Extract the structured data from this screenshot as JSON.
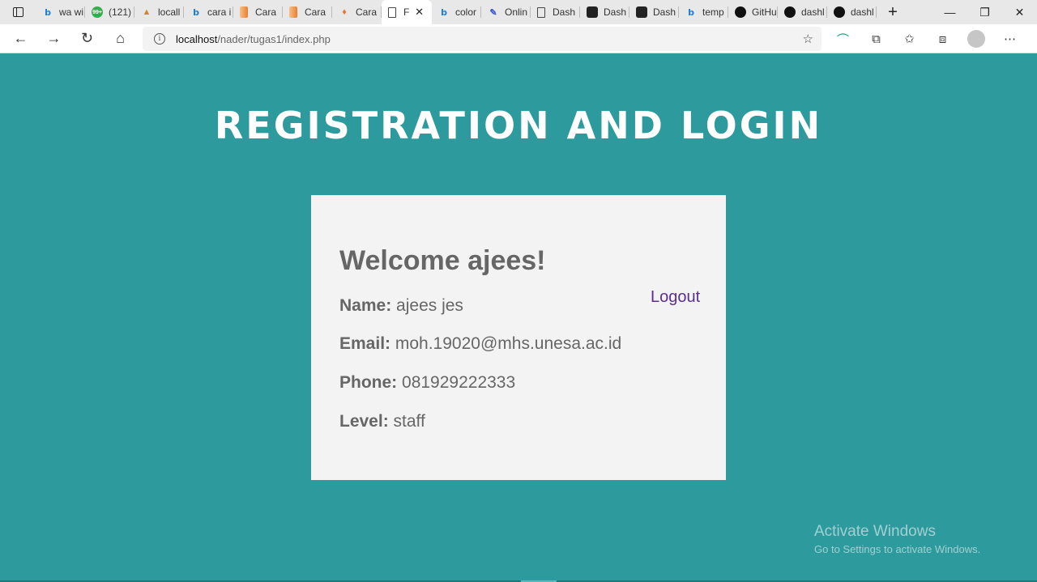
{
  "browser": {
    "tabs": [
      {
        "icon": "bing-icon",
        "label": "wa wi"
      },
      {
        "icon": "notification-icon",
        "label": "(121)"
      },
      {
        "icon": "chart-icon",
        "label": "locall"
      },
      {
        "icon": "bing-icon",
        "label": "cara i"
      },
      {
        "icon": "gradient-icon",
        "label": "Cara"
      },
      {
        "icon": "gradient-icon",
        "label": "Cara"
      },
      {
        "icon": "leaf-icon",
        "label": "Cara"
      },
      {
        "icon": "page-icon",
        "label": "F",
        "active": true
      },
      {
        "icon": "bing-icon",
        "label": "color"
      },
      {
        "icon": "pen-icon",
        "label": "Onlin"
      },
      {
        "icon": "page-icon",
        "label": "Dash"
      },
      {
        "icon": "dashboard-icon",
        "label": "Dash"
      },
      {
        "icon": "dashboard-icon",
        "label": "Dash"
      },
      {
        "icon": "bing-icon",
        "label": "temp"
      },
      {
        "icon": "github-icon",
        "label": "GitHu"
      },
      {
        "icon": "github-icon",
        "label": "dashl"
      },
      {
        "icon": "github-icon",
        "label": "dashl"
      }
    ],
    "address": {
      "host": "localhost",
      "path": "/nader/tugas1/index.php"
    }
  },
  "page": {
    "title": "REGISTRATION AND LOGIN",
    "welcome": "Welcome ajees!",
    "logout_label": "Logout",
    "fields": [
      {
        "label": "Name:",
        "value": "ajees jes"
      },
      {
        "label": "Email:",
        "value": "moh.19020@mhs.unesa.ac.id"
      },
      {
        "label": "Phone:",
        "value": "081929222333"
      },
      {
        "label": "Level:",
        "value": "staff"
      }
    ]
  },
  "watermark": {
    "line1": "Activate Windows",
    "line2": "Go to Settings to activate Windows."
  },
  "colors": {
    "page_background": "#2d9a9e",
    "card_background": "#f4f3f4",
    "logout_link": "#5c2f8a"
  }
}
